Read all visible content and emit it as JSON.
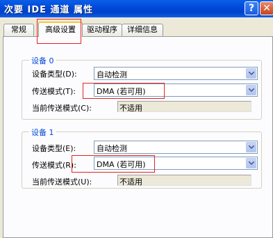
{
  "window": {
    "title": "次要 IDE 通道 属性",
    "help_glyph": "?",
    "close_glyph": "✕"
  },
  "tabs": [
    {
      "label": "常规",
      "active": false
    },
    {
      "label": "高级设置",
      "active": true
    },
    {
      "label": "驱动程序",
      "active": false
    },
    {
      "label": "详细信息",
      "active": false
    }
  ],
  "devices": [
    {
      "legend": "设备 0",
      "device_type_label": "设备类型(D):",
      "device_type_value": "自动检测",
      "transfer_mode_label": "传送模式(T):",
      "transfer_mode_value": "DMA (若可用)",
      "current_mode_label": "当前传送模式(C):",
      "current_mode_value": "不适用"
    },
    {
      "legend": "设备 1",
      "device_type_label": "设备类型(E):",
      "device_type_value": "自动检测",
      "transfer_mode_label": "传送模式(R):",
      "transfer_mode_value": "DMA (若可用)",
      "current_mode_label": "当前传送模式(U):",
      "current_mode_value": "不适用"
    }
  ],
  "colors": {
    "annotation": "#E52222",
    "accent": "#0046D5",
    "titlebar": "#0048D8"
  }
}
